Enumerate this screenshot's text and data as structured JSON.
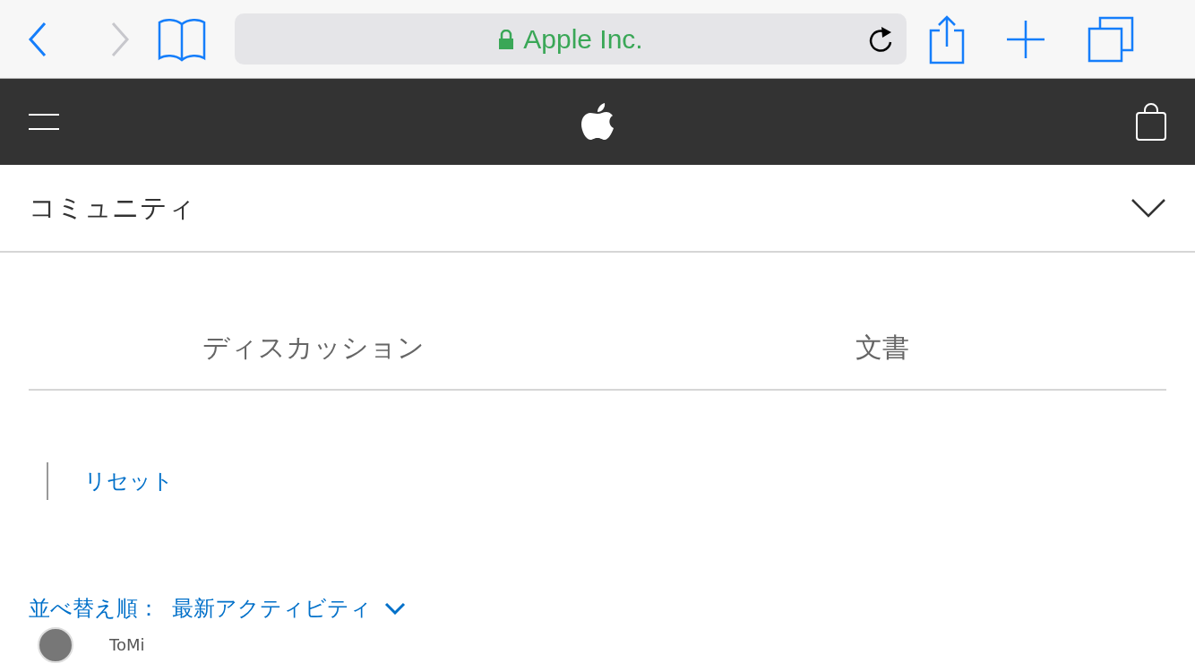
{
  "browser": {
    "address": "Apple Inc.",
    "secure": true,
    "back_enabled": true,
    "forward_enabled": false
  },
  "section": {
    "title": "コミュニティ",
    "expanded": false
  },
  "tabs": [
    {
      "label": "ディスカッション",
      "selected": false
    },
    {
      "label": "文書",
      "selected": false
    }
  ],
  "filter": {
    "reset": "リセット"
  },
  "sort": {
    "label": "並べ替え順：",
    "value": "最新アクティビティ"
  },
  "posts": [
    {
      "author": "ToMi"
    }
  ]
}
